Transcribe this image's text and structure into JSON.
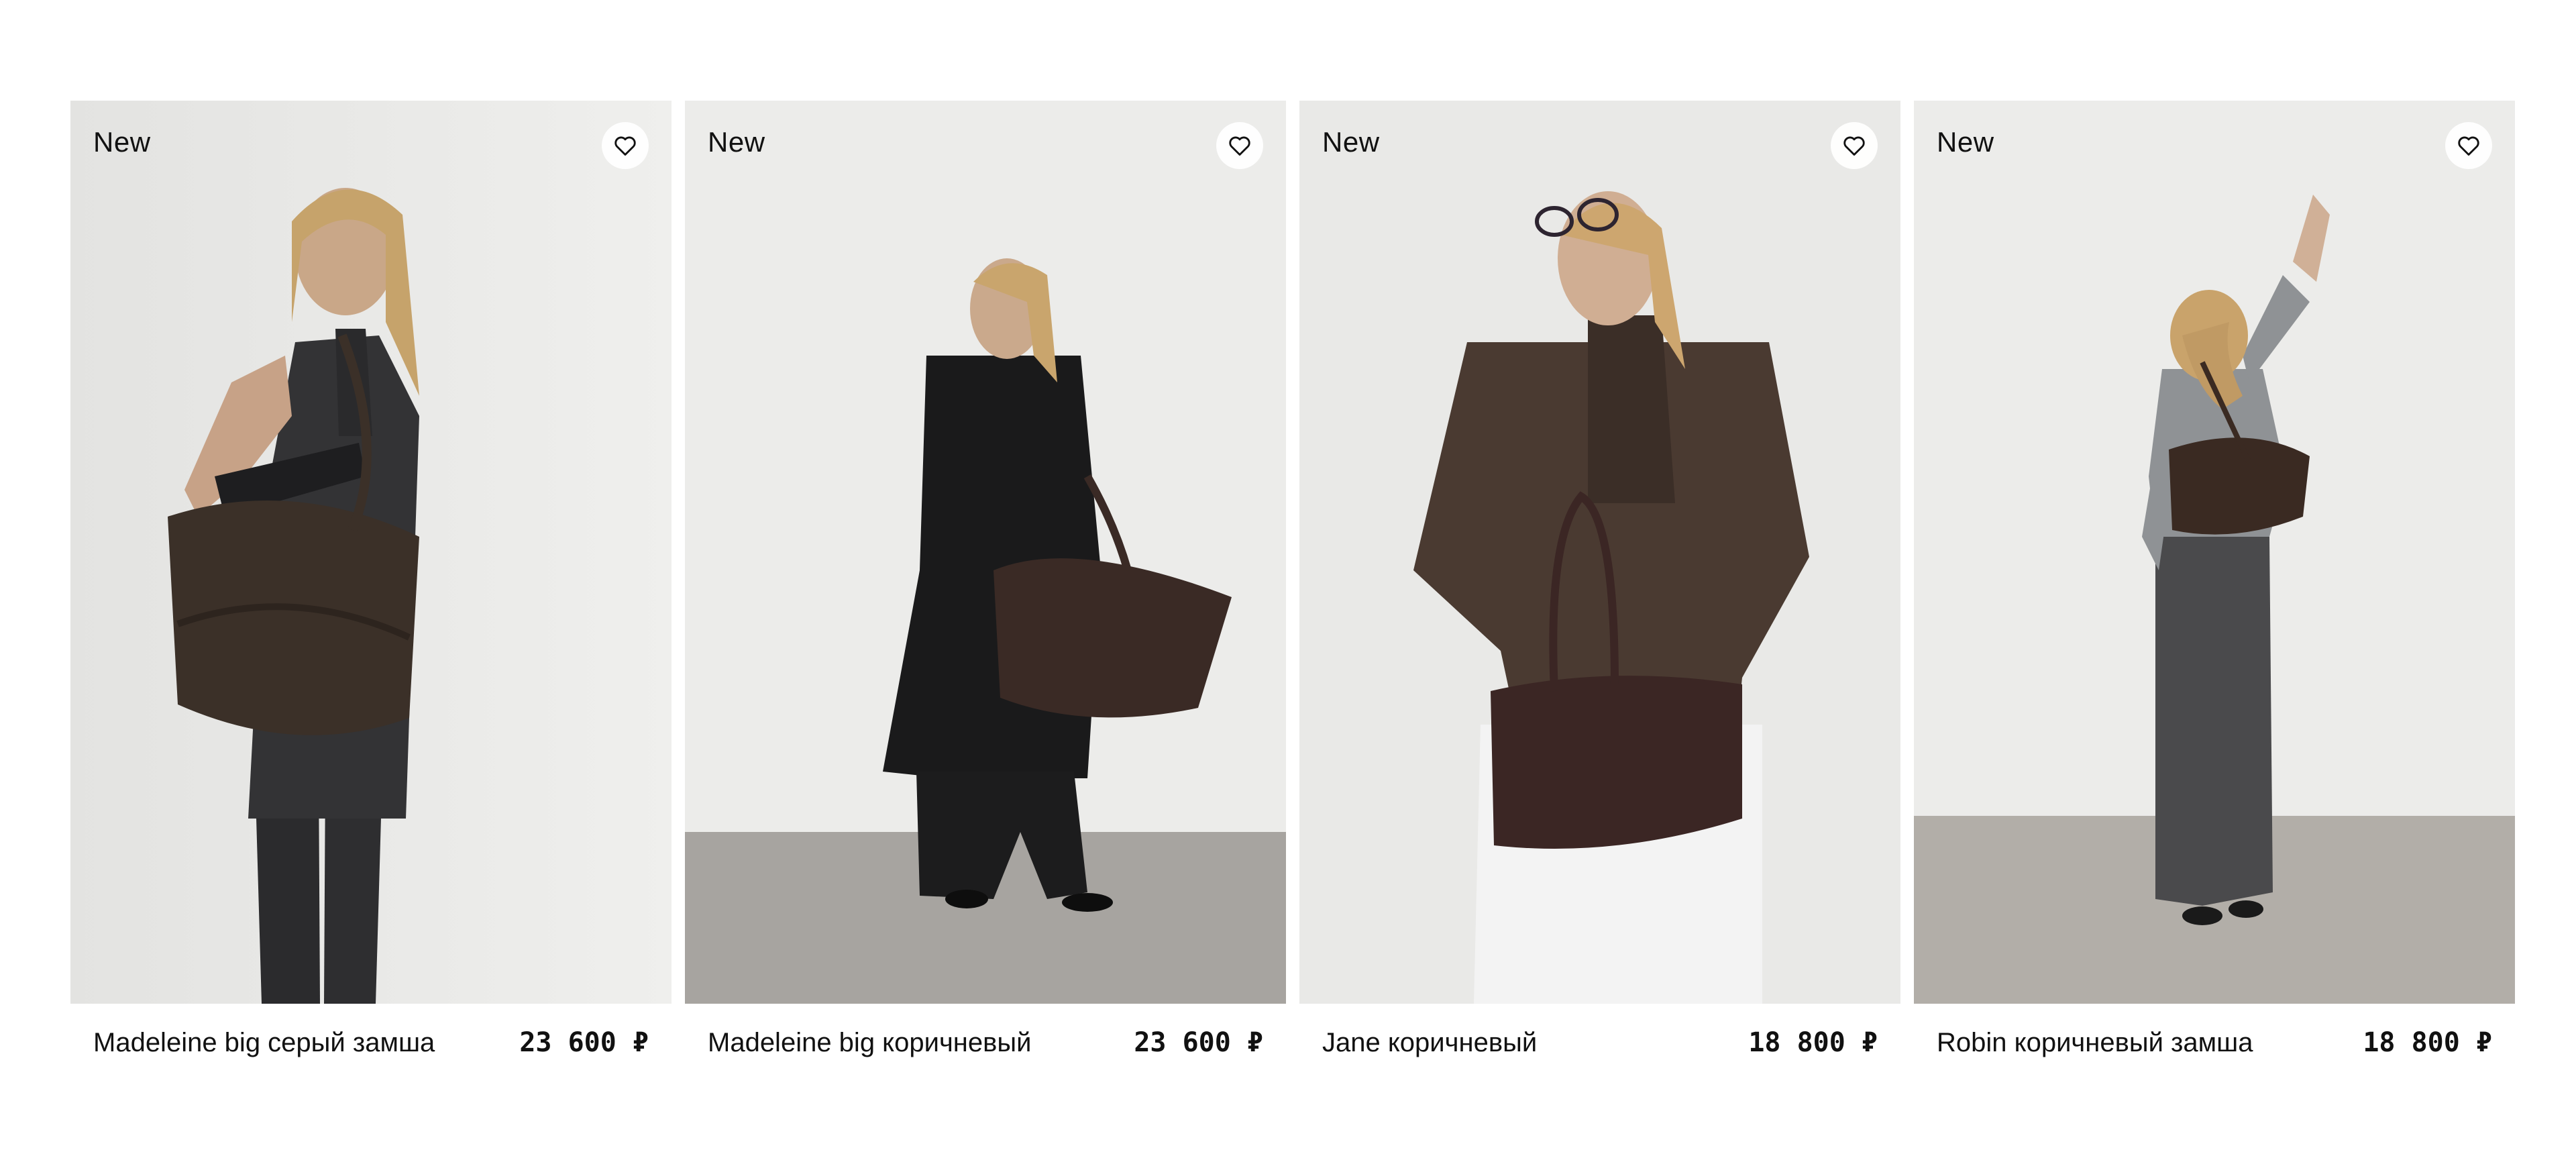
{
  "products": [
    {
      "badge": "New",
      "name": "Madeleine big серый замша",
      "price": "23 600 ₽",
      "favorite_icon": "heart-outline-icon"
    },
    {
      "badge": "New",
      "name": "Madeleine big коричневый",
      "price": "23 600 ₽",
      "favorite_icon": "heart-outline-icon"
    },
    {
      "badge": "New",
      "name": "Jane коричневый",
      "price": "18 800 ₽",
      "favorite_icon": "heart-outline-icon"
    },
    {
      "badge": "New",
      "name": "Robin коричневый замша",
      "price": "18 800 ₽",
      "favorite_icon": "heart-outline-icon"
    }
  ],
  "colors": {
    "background": "#ffffff",
    "wall": "#e7e7e5",
    "floor": "#a9a6a1",
    "text": "#111111"
  }
}
